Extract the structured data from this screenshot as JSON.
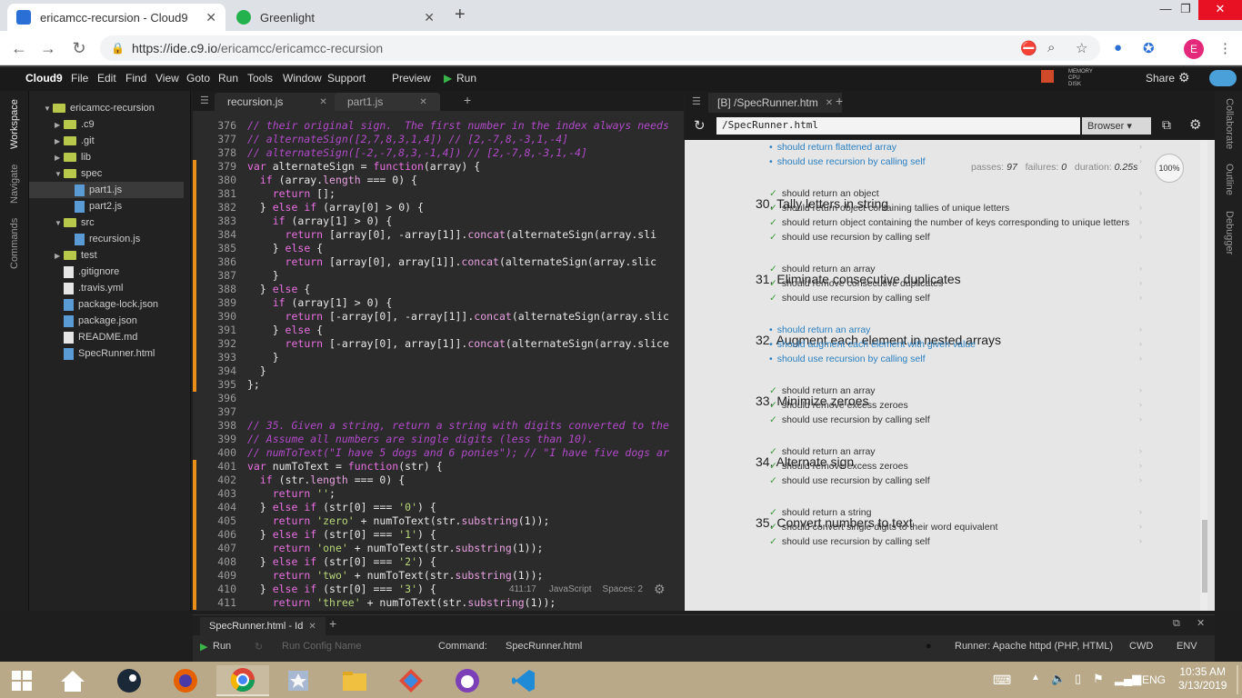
{
  "browser": {
    "tabs": [
      {
        "title": "ericamcc-recursion - Cloud9",
        "active": true
      },
      {
        "title": "Greenlight",
        "active": false
      }
    ],
    "new_tab": "+",
    "url_base": "https://ide.c9.io",
    "url_path": "/ericamcc/ericamcc-recursion",
    "profile_initial": "E"
  },
  "menubar": {
    "app": "Cloud9",
    "items": [
      "File",
      "Edit",
      "Find",
      "View",
      "Goto",
      "Run",
      "Tools",
      "Window",
      "Support"
    ],
    "preview": "Preview",
    "run": "Run",
    "mem_labels": [
      "MEMORY",
      "CPU",
      "DISK"
    ],
    "share": "Share"
  },
  "left_rail": [
    "Workspace",
    "Navigate",
    "Commands"
  ],
  "right_rail": [
    "Collaborate",
    "Outline",
    "Debugger"
  ],
  "tree": [
    {
      "label": "ericamcc-recursion",
      "type": "folder",
      "depth": 0,
      "open": true
    },
    {
      "label": ".c9",
      "type": "folder",
      "depth": 1,
      "open": false
    },
    {
      "label": ".git",
      "type": "folder",
      "depth": 1,
      "open": false
    },
    {
      "label": "lib",
      "type": "folder",
      "depth": 1,
      "open": false
    },
    {
      "label": "spec",
      "type": "folder",
      "depth": 1,
      "open": true
    },
    {
      "label": "part1.js",
      "type": "js",
      "depth": 2,
      "selected": true
    },
    {
      "label": "part2.js",
      "type": "js",
      "depth": 2
    },
    {
      "label": "src",
      "type": "folder",
      "depth": 1,
      "open": true
    },
    {
      "label": "recursion.js",
      "type": "js",
      "depth": 2
    },
    {
      "label": "test",
      "type": "folder",
      "depth": 1,
      "open": false
    },
    {
      "label": ".gitignore",
      "type": "file",
      "depth": 1
    },
    {
      "label": ".travis.yml",
      "type": "file",
      "depth": 1
    },
    {
      "label": "package-lock.json",
      "type": "js",
      "depth": 1
    },
    {
      "label": "package.json",
      "type": "js",
      "depth": 1
    },
    {
      "label": "README.md",
      "type": "file",
      "depth": 1
    },
    {
      "label": "SpecRunner.html",
      "type": "html",
      "depth": 1
    }
  ],
  "editor": {
    "tabs": [
      {
        "label": "recursion.js",
        "active": true
      },
      {
        "label": "part1.js",
        "active": false
      }
    ],
    "lines": [
      {
        "n": "376",
        "t": "// their original sign.  The first number in the index always needs",
        "c": "cmt"
      },
      {
        "n": "377",
        "t": "// alternateSign([2,7,8,3,1,4]) // [2,-7,8,-3,1,-4]",
        "c": "cmt"
      },
      {
        "n": "378",
        "t": "// alternateSign([-2,-7,8,3,-1,4]) // [2,-7,8,-3,1,-4]",
        "c": "cmt"
      },
      {
        "n": "379",
        "t": "var alternateSign = function(array) {",
        "c": "code"
      },
      {
        "n": "380",
        "t": "  if (array.length === 0) {",
        "c": "code"
      },
      {
        "n": "381",
        "t": "    return [];",
        "c": "code"
      },
      {
        "n": "382",
        "t": "  } else if (array[0] > 0) {",
        "c": "code"
      },
      {
        "n": "383",
        "t": "    if (array[1] > 0) {",
        "c": "code"
      },
      {
        "n": "384",
        "t": "      return [array[0], -array[1]].concat(alternateSign(array.sli",
        "c": "code"
      },
      {
        "n": "385",
        "t": "    } else {",
        "c": "code"
      },
      {
        "n": "386",
        "t": "      return [array[0], array[1]].concat(alternateSign(array.slic",
        "c": "code"
      },
      {
        "n": "387",
        "t": "    }",
        "c": "code"
      },
      {
        "n": "388",
        "t": "  } else {",
        "c": "code"
      },
      {
        "n": "389",
        "t": "    if (array[1] > 0) {",
        "c": "code"
      },
      {
        "n": "390",
        "t": "      return [-array[0], -array[1]].concat(alternateSign(array.slic",
        "c": "code"
      },
      {
        "n": "391",
        "t": "    } else {",
        "c": "code"
      },
      {
        "n": "392",
        "t": "      return [-array[0], array[1]].concat(alternateSign(array.slice",
        "c": "code"
      },
      {
        "n": "393",
        "t": "    }",
        "c": "code"
      },
      {
        "n": "394",
        "t": "  }",
        "c": "code"
      },
      {
        "n": "395",
        "t": "};",
        "c": "code"
      },
      {
        "n": "396",
        "t": "",
        "c": "code"
      },
      {
        "n": "397",
        "t": "",
        "c": "code"
      },
      {
        "n": "398",
        "t": "// 35. Given a string, return a string with digits converted to the",
        "c": "cmt"
      },
      {
        "n": "399",
        "t": "// Assume all numbers are single digits (less than 10).",
        "c": "cmt"
      },
      {
        "n": "400",
        "t": "// numToText(\"I have 5 dogs and 6 ponies\"); // \"I have five dogs ar",
        "c": "cmt"
      },
      {
        "n": "401",
        "t": "var numToText = function(str) {",
        "c": "code"
      },
      {
        "n": "402",
        "t": "  if (str.length === 0) {",
        "c": "code"
      },
      {
        "n": "403",
        "t": "    return '';",
        "c": "code"
      },
      {
        "n": "404",
        "t": "  } else if (str[0] === '0') {",
        "c": "code"
      },
      {
        "n": "405",
        "t": "    return 'zero' + numToText(str.substring(1));",
        "c": "code"
      },
      {
        "n": "406",
        "t": "  } else if (str[0] === '1') {",
        "c": "code"
      },
      {
        "n": "407",
        "t": "    return 'one' + numToText(str.substring(1));",
        "c": "code"
      },
      {
        "n": "408",
        "t": "  } else if (str[0] === '2') {",
        "c": "code"
      },
      {
        "n": "409",
        "t": "    return 'two' + numToText(str.substring(1));",
        "c": "code"
      },
      {
        "n": "410",
        "t": "  } else if (str[0] === '3') {",
        "c": "code"
      },
      {
        "n": "411",
        "t": "    return 'three' + numToText(str.substring(1));",
        "c": "code"
      }
    ],
    "status": {
      "pos": "411:17",
      "lang": "JavaScript",
      "spaces": "Spaces: 2"
    }
  },
  "preview": {
    "tab": "[B] /SpecRunner.htm",
    "url": "/SpecRunner.html",
    "browser_label": "Browser",
    "summary": {
      "passes_label": "passes:",
      "passes": "97",
      "failures_label": "failures:",
      "failures": "0",
      "duration_label": "duration:",
      "duration": "0.25s"
    },
    "zoom": "100%",
    "items": [
      {
        "kind": "pend",
        "text": "should return flattened array"
      },
      {
        "kind": "pend",
        "text": "should use recursion by calling self"
      },
      {
        "kind": "h",
        "text": "30. Tally letters in string"
      },
      {
        "kind": "ok",
        "text": "should return an object"
      },
      {
        "kind": "ok",
        "text": "should return object containing tallies of unique letters"
      },
      {
        "kind": "ok",
        "text": "should return object containing the number of keys corresponding to unique letters"
      },
      {
        "kind": "ok",
        "text": "should use recursion by calling self"
      },
      {
        "kind": "h",
        "text": "31. Eliminate consecutive duplicates"
      },
      {
        "kind": "ok",
        "text": "should return an array"
      },
      {
        "kind": "ok",
        "text": "should remove consecutive duplicates"
      },
      {
        "kind": "ok",
        "text": "should use recursion by calling self"
      },
      {
        "kind": "h",
        "text": "32. Augment each element in nested arrays"
      },
      {
        "kind": "pend",
        "text": "should return an array"
      },
      {
        "kind": "pend",
        "text": "should augment each element with given value"
      },
      {
        "kind": "pend",
        "text": "should use recursion by calling self"
      },
      {
        "kind": "h",
        "text": "33. Minimize zeroes"
      },
      {
        "kind": "ok",
        "text": "should return an array"
      },
      {
        "kind": "ok",
        "text": "should remove excess zeroes"
      },
      {
        "kind": "ok",
        "text": "should use recursion by calling self"
      },
      {
        "kind": "h",
        "text": "34. Alternate sign"
      },
      {
        "kind": "ok",
        "text": "should return an array"
      },
      {
        "kind": "ok",
        "text": "should remove excess zeroes"
      },
      {
        "kind": "ok",
        "text": "should use recursion by calling self"
      },
      {
        "kind": "h",
        "text": "35. Convert numbers to text"
      },
      {
        "kind": "ok",
        "text": "should return a string"
      },
      {
        "kind": "ok",
        "text": "should convert single digits to their word equivalent"
      },
      {
        "kind": "ok",
        "text": "should use recursion by calling self"
      }
    ]
  },
  "bottom_panel": {
    "tab": "SpecRunner.html - Id",
    "run": "Run",
    "run_config_placeholder": "Run Config Name",
    "command_label": "Command:",
    "command_value": "SpecRunner.html",
    "runner": "Runner: Apache httpd (PHP, HTML)",
    "cwd": "CWD",
    "env": "ENV"
  },
  "taskbar": {
    "lang": "ENG",
    "time": "10:35 AM",
    "date": "3/13/2019"
  },
  "colors": {
    "accent": "#e88f1a",
    "comment": "#b04ac8",
    "pass": "#3a9a3a",
    "pending": "#2a7fc0"
  }
}
